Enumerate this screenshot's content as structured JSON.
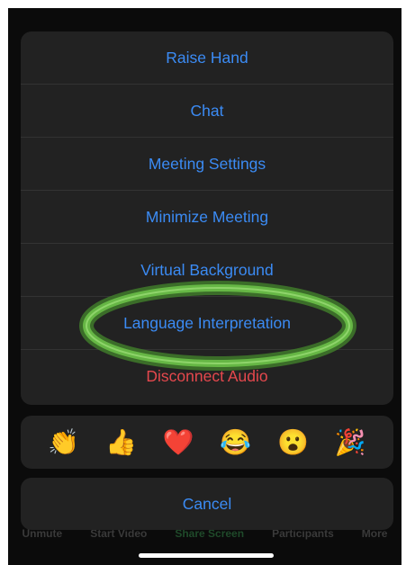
{
  "menu": {
    "items": [
      {
        "label": "Raise Hand"
      },
      {
        "label": "Chat"
      },
      {
        "label": "Meeting Settings"
      },
      {
        "label": "Minimize Meeting"
      },
      {
        "label": "Virtual Background"
      },
      {
        "label": "Language Interpretation"
      },
      {
        "label": "Disconnect Audio"
      }
    ]
  },
  "reactions": {
    "items": [
      "👏",
      "👍",
      "❤️",
      "😂",
      "😮",
      "🎉"
    ]
  },
  "cancel_label": "Cancel",
  "toolbar_behind": [
    "Unmute",
    "Start Video",
    "Share Screen",
    "Participants",
    "More"
  ],
  "colors": {
    "action": "#3b8bf4",
    "destructive": "#e5484d",
    "highlight": "#5aa83a",
    "sheet": "#222222"
  }
}
